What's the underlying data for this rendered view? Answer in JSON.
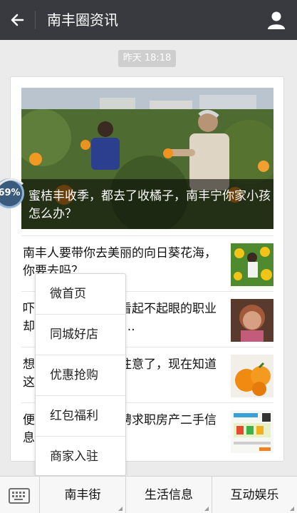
{
  "header": {
    "title": "南丰圈资讯"
  },
  "timestamp": "昨天 18:18",
  "hero": {
    "title": "蜜桔丰收季，都去了收橘子，南丰宁你家小孩怎么办？"
  },
  "articles": [
    {
      "text": "南丰人要带你去美丽的向日葵花海，你要去吗？",
      "thumb_icon": "sunflower-photo"
    },
    {
      "text": "吓死宝宝了！这个看起不起眼的职业却能挣大钱，而你....",
      "thumb_icon": "woman-photo"
    },
    {
      "text": "想吃蜜桔的南丰人注意了，现在知道这些还不晚",
      "thumb_icon": "tangerine-photo"
    },
    {
      "text": "便民信息：南丰招聘求职房产二手信息",
      "thumb_icon": "poster-photo"
    }
  ],
  "floating_badge": {
    "value": "69%"
  },
  "popup_menu": {
    "items": [
      "微首页",
      "同城好店",
      "优惠抢购",
      "红包福利",
      "商家入驻"
    ]
  },
  "bottom_tabs": [
    "南丰街",
    "生活信息",
    "互动娱乐"
  ],
  "colors": {
    "topbar": "#393a3f",
    "background": "#ebebeb",
    "accent": "#3b5b7d"
  }
}
